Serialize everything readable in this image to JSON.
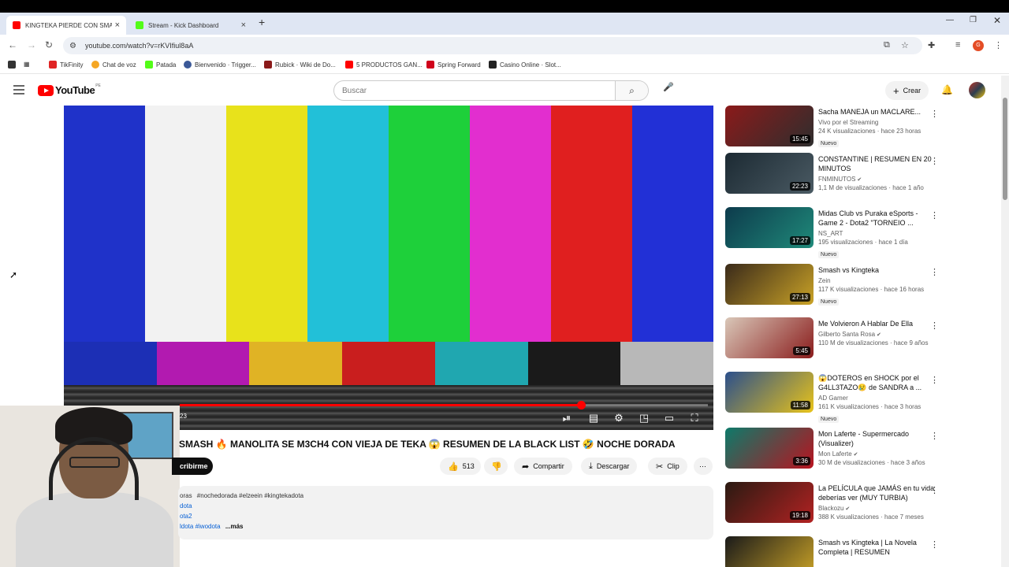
{
  "browser": {
    "tabs": [
      {
        "title": "KINGTEKA PIERDE CON SMASH",
        "favicon_color": "#ff0000",
        "active": true
      },
      {
        "title": "Stream - Kick Dashboard",
        "favicon_color": "#53fc18",
        "active": false
      }
    ],
    "url": "youtube.com/watch?v=rKVIfiul8aA",
    "profile_initial": "G",
    "bookmarks": [
      {
        "label": "TikFinity",
        "color": "#e02424"
      },
      {
        "label": "Chat de voz",
        "color": "#f5a623"
      },
      {
        "label": "Patada",
        "color": "#53fc18"
      },
      {
        "label": "Bienvenido · Trigger...",
        "color": "#3b5998"
      },
      {
        "label": "Rubick · Wiki de Do...",
        "color": "#8b1a1a"
      },
      {
        "label": "5 PRODUCTOS GAN...",
        "color": "#ff0000"
      },
      {
        "label": "Spring Forward",
        "color": "#d0021b"
      },
      {
        "label": "Casino Online · Slot...",
        "color": "#222222"
      }
    ]
  },
  "youtube": {
    "logo_text": "YouTube",
    "country_code": "PE",
    "search_placeholder": "Buscar",
    "create_label": "Crear"
  },
  "player": {
    "time_text": "23",
    "progress": 0.76
  },
  "video": {
    "title": "SMASH 🔥 MANOLITA SE M3CH4 CON VIEJA DE TEKA 😱 RESUMEN DE LA BLACK LIST 🤣 NOCHE DORADA",
    "subscribe_label": "cribirme",
    "likes": "513",
    "share_label": "Compartir",
    "download_label": "Descargar",
    "clip_label": "Clip",
    "description": {
      "line1_prefix": "oras",
      "line1_tags": "#nochedorada #elzeein #kingtekadota",
      "line2": "dota",
      "line3": "ota2",
      "line4_tags": "ldota #iwodota",
      "more_label": "...más"
    }
  },
  "sidebar": {
    "items": [
      {
        "title": "Sacha MANEJA un MACLARE...",
        "channel": "Vivo por el Streaming",
        "meta": "24 K visualizaciones · hace 23 horas",
        "badge": "Nuevo",
        "duration": "15:45",
        "verified": false,
        "colors": [
          "#8b1a1a",
          "#2e2e2e"
        ]
      },
      {
        "title": "CONSTANTINE | RESUMEN EN 20 MINUTOS",
        "channel": "FNMINUTOS",
        "meta": "1,1 M de visualizaciones · hace 1 año",
        "badge": "",
        "duration": "22:23",
        "verified": true,
        "colors": [
          "#1c2a33",
          "#4a5a63"
        ]
      },
      {
        "title": "Midas Club vs Puraka eSports - Game 2 - Dota2 \"TORNEIO ...",
        "channel": "NS_ART",
        "meta": "195 visualizaciones · hace 1 día",
        "badge": "Nuevo",
        "duration": "17:27",
        "verified": false,
        "colors": [
          "#0d3b4c",
          "#1f8a7a"
        ]
      },
      {
        "title": "Smash vs Kingteka",
        "channel": "Zein",
        "meta": "117 K visualizaciones · hace 16 horas",
        "badge": "Nuevo",
        "duration": "27:13",
        "verified": false,
        "colors": [
          "#3a2a1a",
          "#c9a227"
        ]
      },
      {
        "title": "Me Volvieron A Hablar De Ella",
        "channel": "Gilberto Santa Rosa",
        "meta": "110 M de visualizaciones · hace 9 años",
        "badge": "",
        "duration": "5:45",
        "verified": true,
        "colors": [
          "#d9c7b8",
          "#8a1c1c"
        ]
      },
      {
        "title": "😱DOTEROS en SHOCK por el G4LL3TAZO😢 de SANDRA a ...",
        "channel": "AD Gamer",
        "meta": "161 K visualizaciones · hace 3 horas",
        "badge": "Nuevo",
        "duration": "11:58",
        "verified": false,
        "colors": [
          "#2b4f8c",
          "#e8c31a"
        ]
      },
      {
        "title": "Mon Laferte - Supermercado (Visualizer)",
        "channel": "Mon Laferte",
        "meta": "30 M de visualizaciones · hace 3 años",
        "badge": "",
        "duration": "3:36",
        "verified": true,
        "colors": [
          "#0d7a6a",
          "#b8131f"
        ]
      },
      {
        "title": "La PELÍCULA que JAMÁS en tu vida deberías ver (MUY TURBIA)",
        "channel": "Blackozu",
        "meta": "388 K visualizaciones · hace 7 meses",
        "badge": "",
        "duration": "19:18",
        "verified": true,
        "colors": [
          "#2a1a12",
          "#b22222"
        ]
      },
      {
        "title": "Smash vs Kingteka | La Novela Completa | RESUMEN",
        "channel": "",
        "meta": "",
        "badge": "",
        "duration": "",
        "verified": false,
        "colors": [
          "#1a1a1a",
          "#c9a227"
        ]
      }
    ]
  }
}
